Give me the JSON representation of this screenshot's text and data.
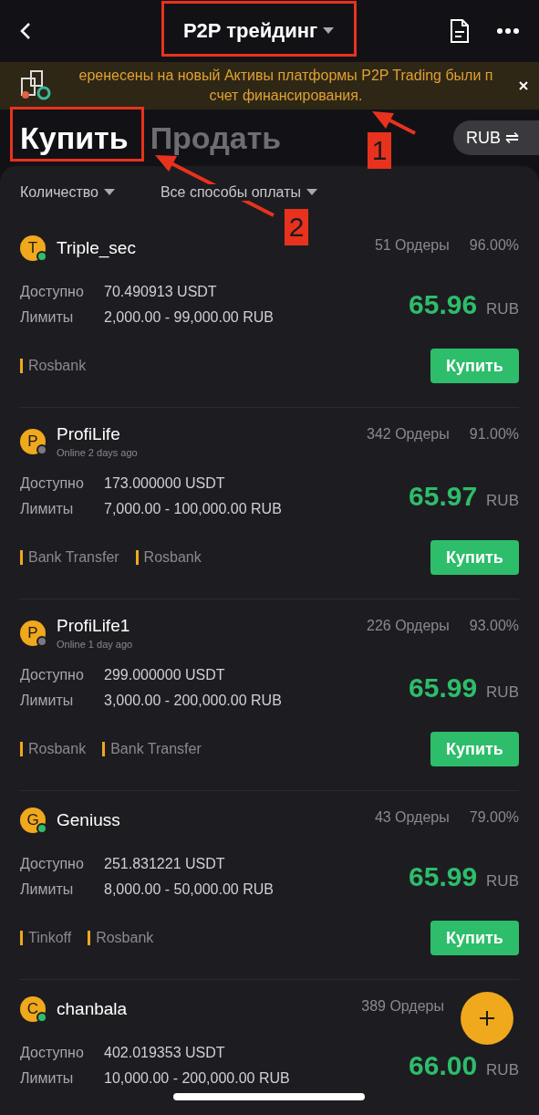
{
  "header": {
    "title": "P2P трейдинг"
  },
  "banner": {
    "lines": [
      "еренесены на новый Активы платформы P2P Trading были п",
      "счет финансирования."
    ]
  },
  "tabs": [
    {
      "label": "Купить",
      "selected": true
    },
    {
      "label": "Продать",
      "selected": false
    }
  ],
  "currency": {
    "label": "RUB",
    "icon": "⇌"
  },
  "filters": [
    {
      "label": "Количество"
    },
    {
      "label": "Все способы оплаты"
    }
  ],
  "sellers": [
    {
      "initial": "T",
      "name": "Triple_sec",
      "online": true,
      "orders": "51 Ордеры",
      "rate": "96.00%",
      "available_label": "Доступно",
      "available": "70.490913 USDT",
      "limits_label": "Лимиты",
      "limits": "2,000.00 - 99,000.00 RUB",
      "price": "65.96",
      "price_currency": "RUB",
      "methods": [
        "Rosbank"
      ],
      "button": "Купить"
    },
    {
      "initial": "P",
      "name": "ProfiLife",
      "online": false,
      "last_seen": "Online 2 days ago",
      "orders": "342 Ордеры",
      "rate": "91.00%",
      "available_label": "Доступно",
      "available": "173.000000 USDT",
      "limits_label": "Лимиты",
      "limits": "7,000.00 - 100,000.00 RUB",
      "price": "65.97",
      "price_currency": "RUB",
      "methods": [
        "Bank Transfer",
        "Rosbank"
      ],
      "button": "Купить"
    },
    {
      "initial": "P",
      "name": "ProfiLife1",
      "online": false,
      "last_seen": "Online 1 day ago",
      "orders": "226 Ордеры",
      "rate": "93.00%",
      "available_label": "Доступно",
      "available": "299.000000 USDT",
      "limits_label": "Лимиты",
      "limits": "3,000.00 - 200,000.00 RUB",
      "price": "65.99",
      "price_currency": "RUB",
      "methods": [
        "Rosbank",
        "Bank Transfer"
      ],
      "button": "Купить"
    },
    {
      "initial": "G",
      "name": "Geniuss",
      "online": true,
      "orders": "43 Ордеры",
      "rate": "79.00%",
      "available_label": "Доступно",
      "available": "251.831221 USDT",
      "limits_label": "Лимиты",
      "limits": "8,000.00 - 50,000.00 RUB",
      "price": "65.99",
      "price_currency": "RUB",
      "methods": [
        "Tinkoff",
        "Rosbank"
      ],
      "button": "Купить"
    },
    {
      "initial": "C",
      "name": "chanbala",
      "online": true,
      "orders": "389 Ордеры",
      "available_label": "Доступно",
      "available": "402.019353 USDT",
      "limits_label": "Лимиты",
      "limits": "10,000.00 - 200,000.00 RUB",
      "price": "66.00",
      "price_currency": "RUB"
    }
  ],
  "annotations": [
    {
      "label": "1"
    },
    {
      "label": "2"
    }
  ]
}
